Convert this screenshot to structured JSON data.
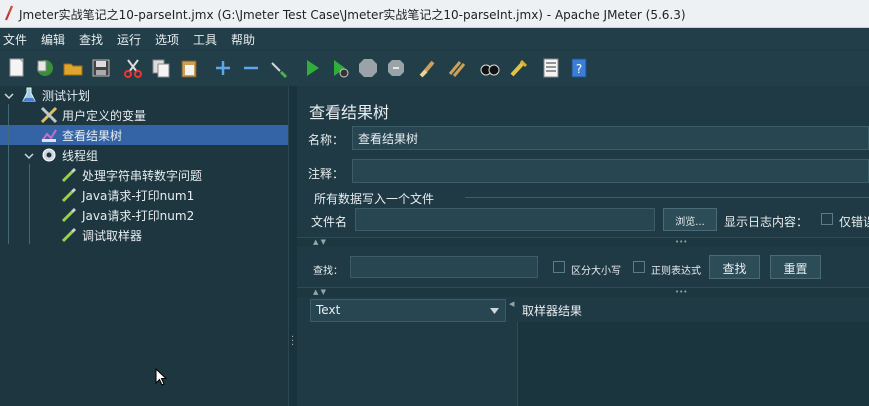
{
  "window": {
    "title": "Jmeter实战笔记之10-parseInt.jmx (G:\\Jmeter Test Case\\Jmeter实战笔记之10-parseInt.jmx) - Apache JMeter (5.6.3)"
  },
  "menu": [
    "文件",
    "编辑",
    "查找",
    "运行",
    "选项",
    "工具",
    "帮助"
  ],
  "toolbar": {
    "icons": [
      "new-icon",
      "templates-icon",
      "open-icon",
      "save-icon",
      "cut-icon",
      "copy-icon",
      "paste-icon",
      "expand-icon",
      "collapse-icon",
      "toggle-icon",
      "start-icon",
      "start-no-pause-icon",
      "stop-icon",
      "shutdown-icon",
      "clear-icon",
      "clear-all-icon",
      "search-icon",
      "reset-search-icon",
      "function-helper-icon",
      "help-icon"
    ]
  },
  "tree": {
    "items": [
      {
        "label": "测试计划",
        "icon": "flask-icon"
      },
      {
        "label": "用户定义的变量",
        "icon": "tools-icon"
      },
      {
        "label": "查看结果树",
        "icon": "chart-icon"
      },
      {
        "label": "线程组",
        "icon": "gear-icon"
      },
      {
        "label": "处理字符串转数字问题",
        "icon": "pipette-icon"
      },
      {
        "label": "Java请求-打印num1",
        "icon": "pipette-icon"
      },
      {
        "label": "Java请求-打印num2",
        "icon": "pipette-icon"
      },
      {
        "label": "调试取样器",
        "icon": "pipette-icon"
      }
    ]
  },
  "panel": {
    "title": "查看结果树",
    "name_label": "名称：",
    "name_value": "查看结果树",
    "comment_label": "注释：",
    "comment_value": "",
    "file_section": "所有数据写入一个文件",
    "filename_label": "文件名",
    "filename_value": "",
    "browse_label": "浏览...",
    "log_label": "显示日志内容：",
    "errors_label": "仅错误",
    "search_label": "查找：",
    "search_value": "",
    "case_label": "区分大小写",
    "regex_label": "正则表达式",
    "find_button": "查找",
    "reset_button": "重置",
    "renderer": "Text",
    "result_tab": "取样器结果"
  }
}
